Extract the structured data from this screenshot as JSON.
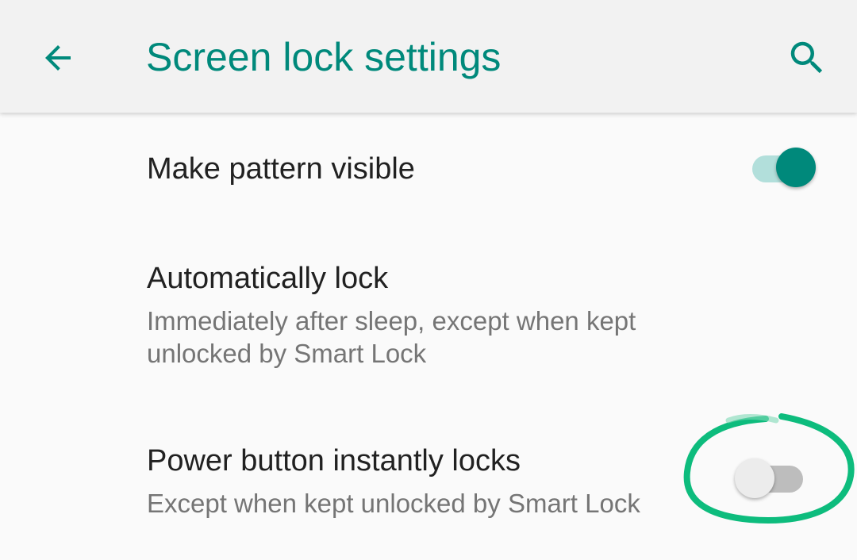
{
  "app_bar": {
    "title": "Screen lock settings",
    "back_icon": "arrow-back-icon",
    "search_icon": "search-icon"
  },
  "preferences": [
    {
      "title": "Make pattern visible",
      "summary": "",
      "has_switch": true,
      "switch_on": true
    },
    {
      "title": "Automatically lock",
      "summary": "Immediately after sleep, except when kept unlocked by Smart Lock",
      "has_switch": false
    },
    {
      "title": "Power button instantly locks",
      "summary": "Except when kept unlocked by Smart Lock",
      "has_switch": true,
      "switch_on": false
    }
  ],
  "colors": {
    "accent": "#00897b",
    "switch_on_track": "#b2dfdb",
    "switch_off_track": "#bdbdbd",
    "switch_off_thumb": "#ececec",
    "annotation_stroke": "#00b876"
  }
}
